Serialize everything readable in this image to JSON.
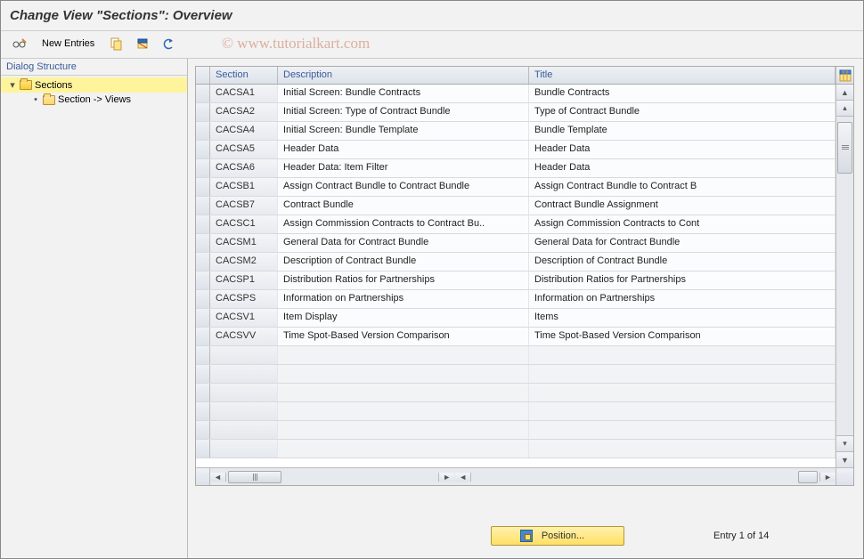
{
  "window": {
    "title": "Change View \"Sections\": Overview"
  },
  "toolbar": {
    "new_entries_label": "New Entries"
  },
  "watermark": "© www.tutorialkart.com",
  "dialog_structure": {
    "header": "Dialog Structure",
    "root": {
      "label": "Sections",
      "expanded": true
    },
    "child": {
      "label": "Section -> Views"
    }
  },
  "grid": {
    "columns": {
      "section": "Section",
      "description": "Description",
      "title": "Title"
    },
    "rows": [
      {
        "section": "CACSA1",
        "description": "Initial Screen: Bundle Contracts",
        "title": "Bundle Contracts"
      },
      {
        "section": "CACSA2",
        "description": "Initial Screen: Type of Contract Bundle",
        "title": "Type of Contract Bundle"
      },
      {
        "section": "CACSA4",
        "description": "Initial Screen: Bundle Template",
        "title": "Bundle Template"
      },
      {
        "section": "CACSA5",
        "description": "Header Data",
        "title": "Header Data"
      },
      {
        "section": "CACSA6",
        "description": "Header Data: Item Filter",
        "title": "Header Data"
      },
      {
        "section": "CACSB1",
        "description": "Assign Contract Bundle to Contract Bundle",
        "title": "Assign Contract Bundle to Contract B"
      },
      {
        "section": "CACSB7",
        "description": "Contract Bundle",
        "title": "Contract Bundle Assignment"
      },
      {
        "section": "CACSC1",
        "description": "Assign Commission Contracts to Contract Bu..",
        "title": "Assign Commission Contracts to Cont"
      },
      {
        "section": "CACSM1",
        "description": "General Data for Contract Bundle",
        "title": "General Data for Contract Bundle"
      },
      {
        "section": "CACSM2",
        "description": "Description of Contract Bundle",
        "title": "Description of Contract Bundle"
      },
      {
        "section": "CACSP1",
        "description": "Distribution Ratios for Partnerships",
        "title": "Distribution Ratios for Partnerships"
      },
      {
        "section": "CACSPS",
        "description": "Information on Partnerships",
        "title": "Information on Partnerships"
      },
      {
        "section": "CACSV1",
        "description": "Item Display",
        "title": "Items"
      },
      {
        "section": "CACSVV",
        "description": "Time Spot-Based Version Comparison",
        "title": "Time Spot-Based Version Comparison"
      }
    ],
    "empty_row_count": 6
  },
  "footer": {
    "position_button_label": "Position...",
    "status_text": "Entry 1 of 14"
  }
}
